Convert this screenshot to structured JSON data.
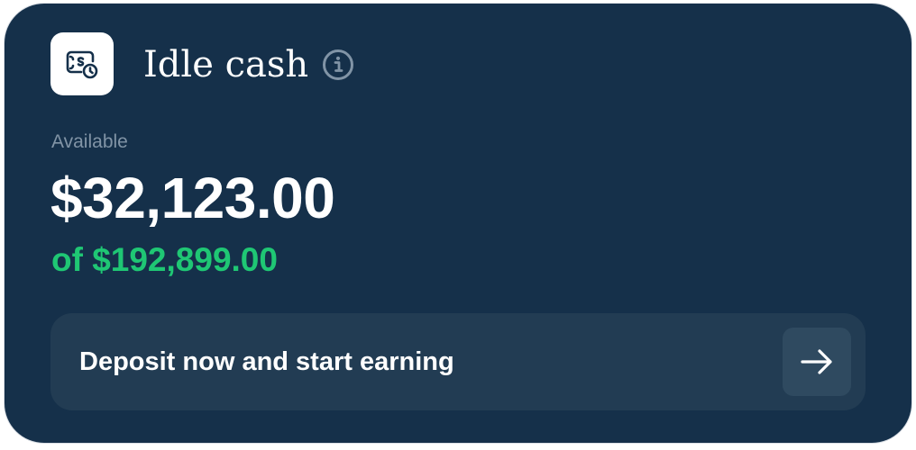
{
  "header": {
    "title": "Idle cash",
    "icon": "cash-clock-icon",
    "info_icon": "info-icon"
  },
  "balance": {
    "label": "Available",
    "amount": "$32,123.00",
    "total": "of $192,899.00"
  },
  "cta": {
    "label": "Deposit now and start earning",
    "icon": "arrow-right-icon"
  },
  "colors": {
    "card_background": "#15304A",
    "cta_background": "#223C53",
    "arrow_button_background": "#2F4A60",
    "accent_green": "#1FC774",
    "muted_label": "#8194A6"
  }
}
